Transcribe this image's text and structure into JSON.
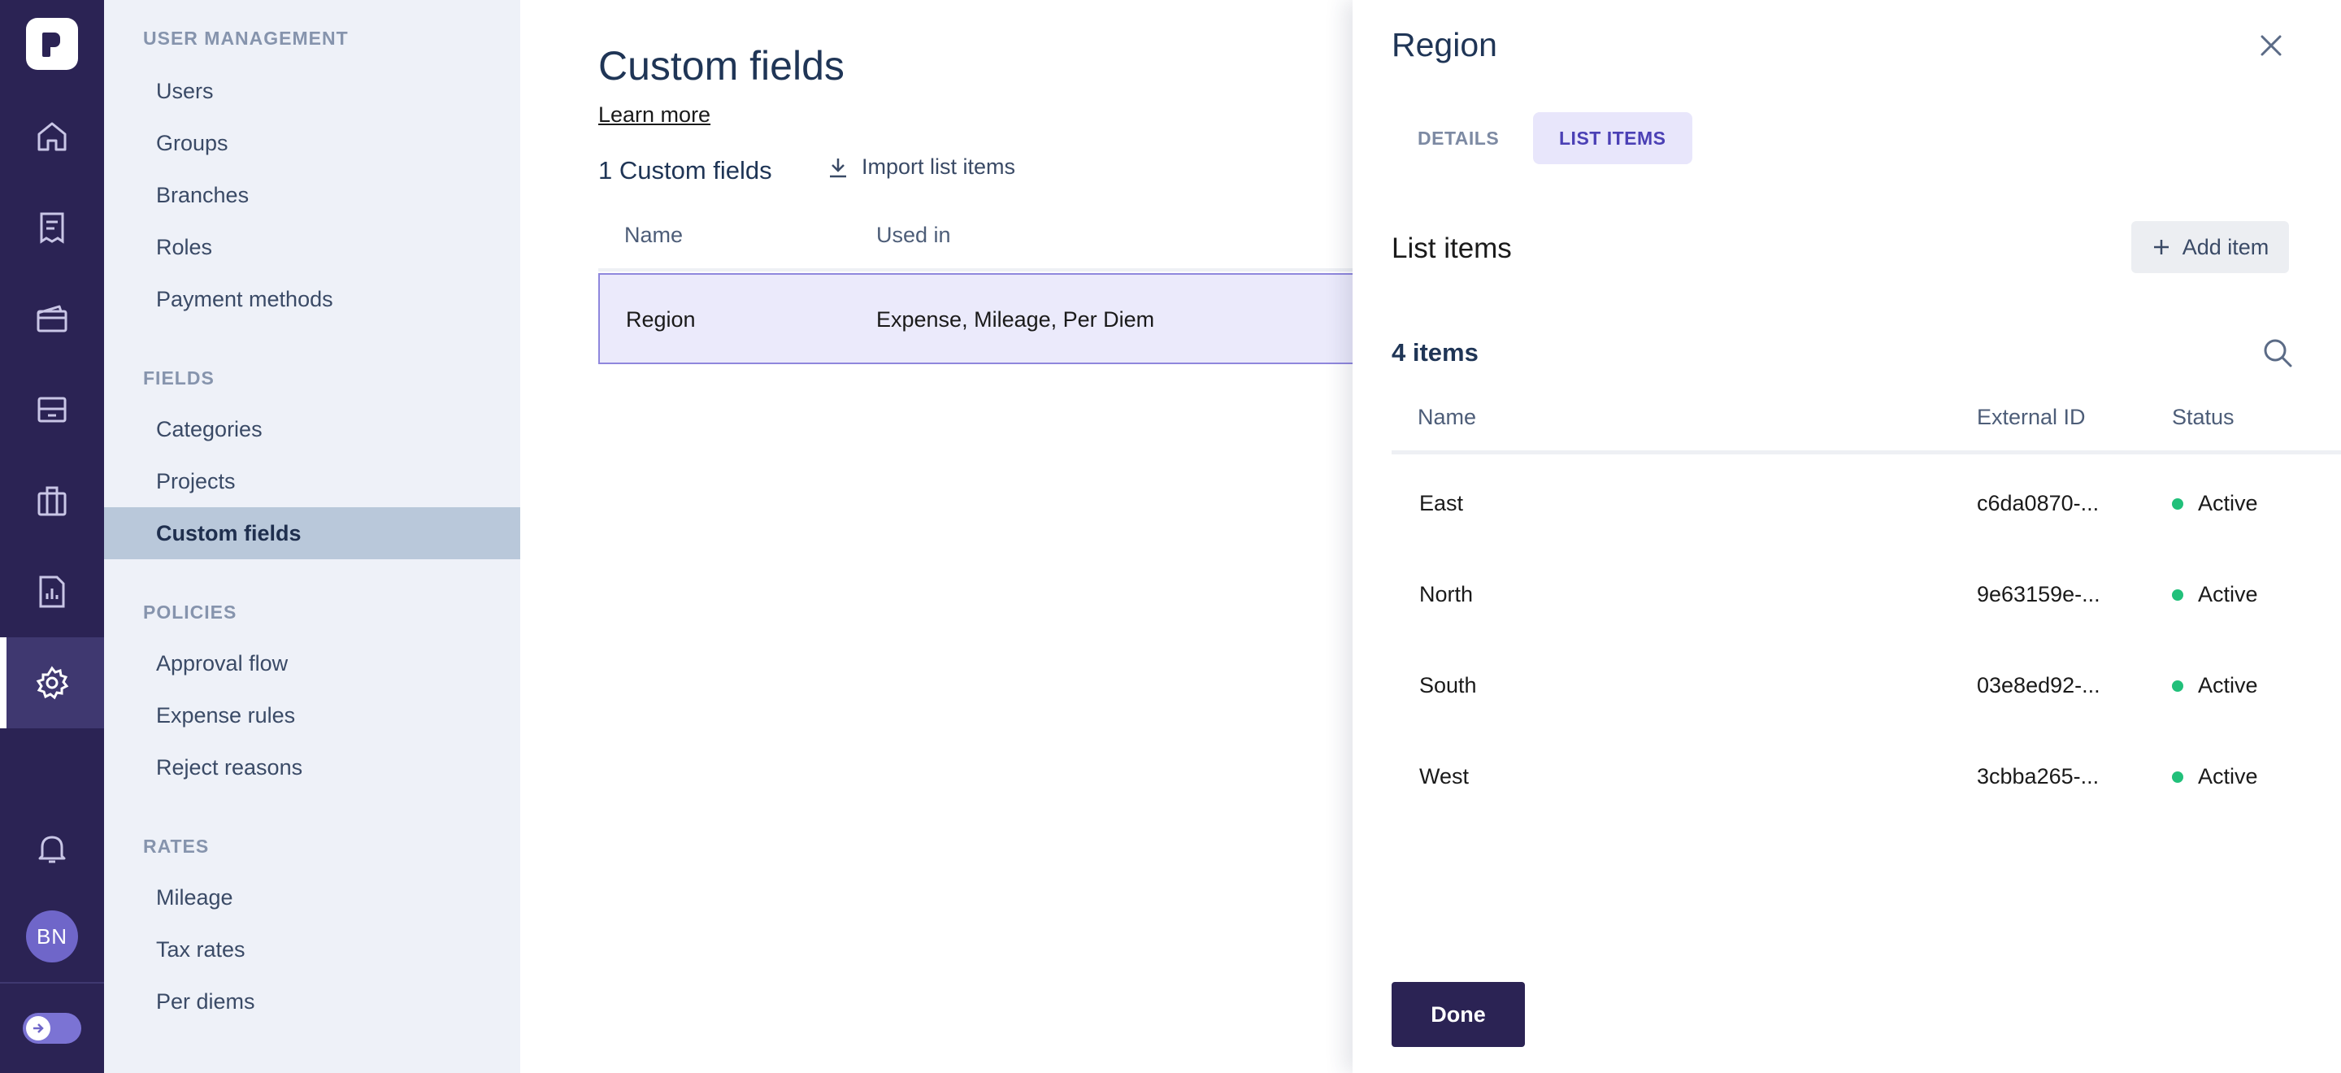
{
  "rail": {
    "avatar_initials": "BN",
    "items": [
      {
        "icon": "home-icon"
      },
      {
        "icon": "receipt-icon"
      },
      {
        "icon": "wallet-icon"
      },
      {
        "icon": "inbox-icon"
      },
      {
        "icon": "briefcase-icon"
      },
      {
        "icon": "report-icon"
      },
      {
        "icon": "settings-gear-icon",
        "active": true
      }
    ]
  },
  "nav": {
    "sections": [
      {
        "title": "USER MANAGEMENT",
        "items": [
          "Users",
          "Groups",
          "Branches",
          "Roles",
          "Payment methods"
        ]
      },
      {
        "title": "FIELDS",
        "items": [
          "Categories",
          "Projects",
          "Custom fields"
        ]
      },
      {
        "title": "POLICIES",
        "items": [
          "Approval flow",
          "Expense rules",
          "Reject reasons"
        ]
      },
      {
        "title": "RATES",
        "items": [
          "Mileage",
          "Tax rates",
          "Per diems"
        ]
      }
    ],
    "active_item": "Custom fields"
  },
  "main": {
    "title": "Custom fields",
    "learn_more": "Learn more",
    "count_label": "1 Custom fields",
    "import_label": "Import list items",
    "columns": [
      "Name",
      "Used in"
    ],
    "rows": [
      {
        "name": "Region",
        "used_in": "Expense, Mileage, Per Diem"
      }
    ]
  },
  "drawer": {
    "title": "Region",
    "tabs": [
      "DETAILS",
      "LIST ITEMS"
    ],
    "active_tab": "LIST ITEMS",
    "section_title": "List items",
    "add_item_label": "Add item",
    "items_count": "4 items",
    "columns": [
      "Name",
      "External ID",
      "Status"
    ],
    "rows": [
      {
        "name": "East",
        "external_id": "c6da0870-...",
        "status": "Active"
      },
      {
        "name": "North",
        "external_id": "9e63159e-...",
        "status": "Active"
      },
      {
        "name": "South",
        "external_id": "03e8ed92-...",
        "status": "Active"
      },
      {
        "name": "West",
        "external_id": "3cbba265-...",
        "status": "Active"
      }
    ],
    "done_label": "Done"
  },
  "colors": {
    "rail_bg": "#2b2354",
    "accent": "#4b40b5",
    "status_active": "#21c07a",
    "selected_row": "#ebeafb"
  }
}
